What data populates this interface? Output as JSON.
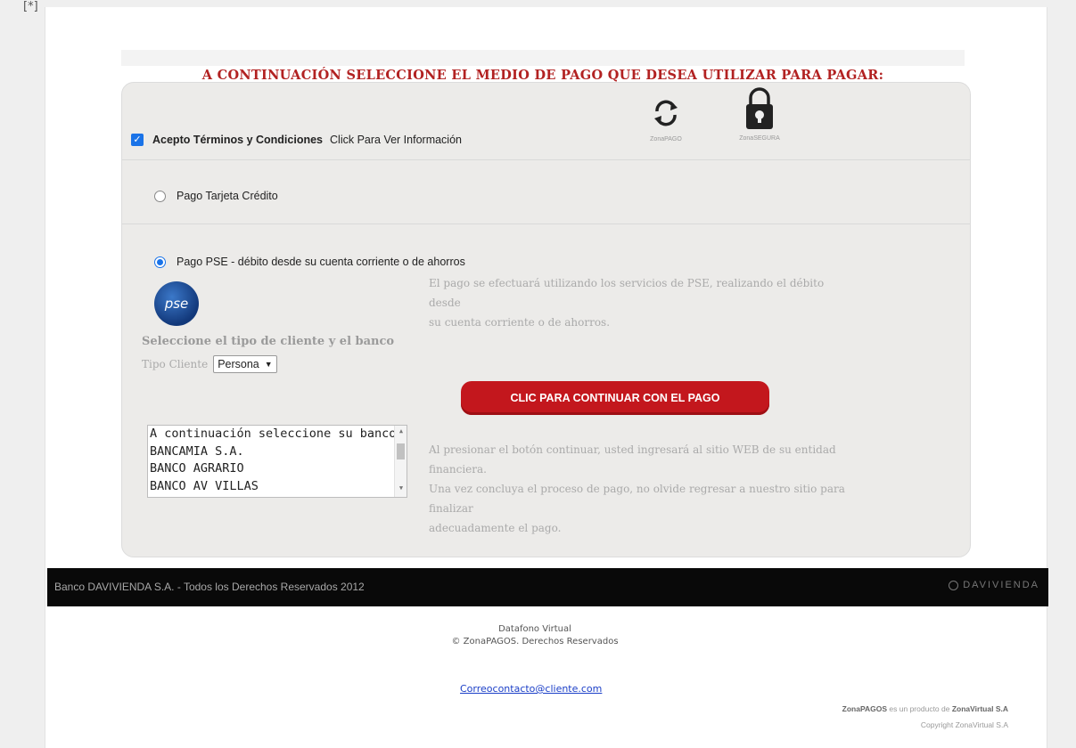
{
  "corner_mark": "[*]",
  "title": "A CONTINUACIÓN SELECCIONE EL MEDIO DE PAGO QUE DESEA UTILIZAR PARA PAGAR:",
  "terms": {
    "checked": true,
    "label": "Acepto Términos y Condiciones",
    "link": "Click Para Ver Información"
  },
  "badges": [
    {
      "icon": "refresh-icon",
      "caption": "ZonaPAGO"
    },
    {
      "icon": "lock-icon",
      "caption": "ZonaSEGURA"
    }
  ],
  "payment_options": {
    "credit_card": {
      "label": "Pago Tarjeta Crédito",
      "selected": false
    },
    "pse": {
      "label": "Pago PSE - débito desde su cuenta corriente o de ahorros",
      "selected": true,
      "logo_text": "pse"
    }
  },
  "pse_description": [
    "El pago se efectuará utilizando los servicios de PSE, realizando el débito",
    "desde",
    "su cuenta corriente o de ahorros."
  ],
  "client_section": {
    "title": "Seleccione el tipo de cliente y el banco",
    "tipo_label": "Tipo Cliente",
    "tipo_value": "Persona"
  },
  "continue_button": "CLIC PARA CONTINUAR CON EL PAGO",
  "bank_list": [
    "A continuación seleccione su banco",
    "BANCAMIA S.A.",
    "BANCO AGRARIO",
    "BANCO AV VILLAS"
  ],
  "bank_note": [
    "Al presionar el botón continuar, usted ingresará al sitio WEB de su entidad",
    "financiera.",
    "Una vez concluya el proceso de pago, no olvide regresar a nuestro sitio para",
    "finalizar",
    "adecuadamente el pago."
  ],
  "footer": {
    "copyright": "Banco DAVIVIENDA S.A. - Todos los Derechos Reservados 2012",
    "brand": "DAVIVIENDA"
  },
  "datafono": {
    "line1": "Datafono Virtual",
    "line2": "© ZonaPAGOS. Derechos Reservados"
  },
  "contact_email": "Correocontacto@cliente.com",
  "zonapagos": {
    "brand": "ZonaPAGOS",
    "middle": "es un producto de",
    "company": "ZonaVirtual S.A",
    "copyright": "Copyright ZonaVirtual S.A"
  }
}
